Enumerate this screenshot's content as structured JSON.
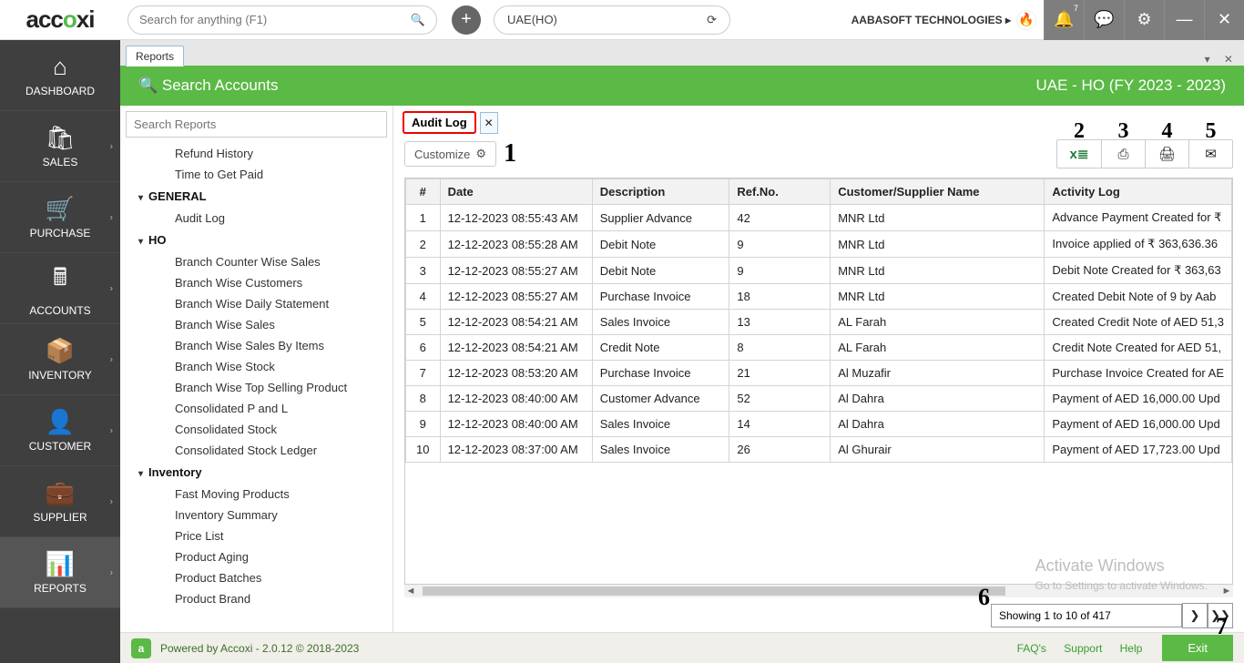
{
  "top": {
    "search_placeholder": "Search for anything (F1)",
    "org": "UAE(HO)",
    "company": "AABASOFT TECHNOLOGIES ▸",
    "notif_count": "7"
  },
  "nav": {
    "dashboard": "DASHBOARD",
    "sales": "SALES",
    "purchase": "PURCHASE",
    "accounts": "ACCOUNTS",
    "inventory": "INVENTORY",
    "customer": "CUSTOMER",
    "supplier": "SUPPLIER",
    "reports": "REPORTS"
  },
  "report_tab": "Reports",
  "green": {
    "search": "Search Accounts",
    "fy": "UAE - HO (FY 2023 - 2023)"
  },
  "tree": {
    "search_placeholder": "Search Reports",
    "items_a": [
      "Refund History",
      "Time to Get Paid"
    ],
    "head1": "GENERAL",
    "items_b": [
      "Audit Log"
    ],
    "head2": "HO",
    "items_c": [
      "Branch Counter Wise Sales",
      "Branch Wise Customers",
      "Branch Wise Daily Statement",
      "Branch Wise Sales",
      "Branch Wise Sales By Items",
      "Branch Wise Stock",
      "Branch Wise Top Selling Product",
      "Consolidated P and L",
      "Consolidated Stock",
      "Consolidated Stock Ledger"
    ],
    "head3": "Inventory",
    "items_d": [
      "Fast Moving Products",
      "Inventory Summary",
      "Price List",
      "Product Aging",
      "Product Batches",
      "Product Brand"
    ]
  },
  "al_tab": "Audit Log",
  "customize": "Customize",
  "cols": [
    "#",
    "Date",
    "Description",
    "Ref.No.",
    "Customer/Supplier Name",
    "Activity Log"
  ],
  "rows": [
    {
      "n": "1",
      "date": "12-12-2023 08:55:43 AM",
      "desc": "Supplier Advance",
      "ref": "42",
      "cust": "MNR Ltd",
      "act": "Advance Payment Created for ₹"
    },
    {
      "n": "2",
      "date": "12-12-2023 08:55:28 AM",
      "desc": "Debit Note",
      "ref": "9",
      "cust": "MNR Ltd",
      "act": "Invoice applied of ₹ 363,636.36"
    },
    {
      "n": "3",
      "date": "12-12-2023 08:55:27 AM",
      "desc": "Debit Note",
      "ref": "9",
      "cust": "MNR Ltd",
      "act": "Debit Note Created for ₹ 363,63"
    },
    {
      "n": "4",
      "date": "12-12-2023 08:55:27 AM",
      "desc": "Purchase Invoice",
      "ref": "18",
      "cust": "MNR Ltd",
      "act": "Created Debit Note of 9 by Aab"
    },
    {
      "n": "5",
      "date": "12-12-2023 08:54:21 AM",
      "desc": "Sales Invoice",
      "ref": "13",
      "cust": "AL Farah",
      "act": "Created Credit Note of AED 51,3"
    },
    {
      "n": "6",
      "date": "12-12-2023 08:54:21 AM",
      "desc": "Credit Note",
      "ref": "8",
      "cust": "AL Farah",
      "act": "Credit Note Created for AED 51,"
    },
    {
      "n": "7",
      "date": "12-12-2023 08:53:20 AM",
      "desc": "Purchase Invoice",
      "ref": "21",
      "cust": "Al Muzafir",
      "act": "Purchase Invoice Created for AE"
    },
    {
      "n": "8",
      "date": "12-12-2023 08:40:00 AM",
      "desc": "Customer Advance",
      "ref": "52",
      "cust": "Al Dahra",
      "act": "Payment of AED 16,000.00 Upd"
    },
    {
      "n": "9",
      "date": "12-12-2023 08:40:00 AM",
      "desc": "Sales Invoice",
      "ref": "14",
      "cust": "Al Dahra",
      "act": "Payment of AED 16,000.00 Upd"
    },
    {
      "n": "10",
      "date": "12-12-2023 08:37:00 AM",
      "desc": "Sales Invoice",
      "ref": "26",
      "cust": "Al Ghurair",
      "act": "Payment of AED 17,723.00 Upd"
    }
  ],
  "pager_text": "Showing 1 to 10 of 417",
  "watermark1": "Activate Windows",
  "watermark2": "Go to Settings to activate Windows.",
  "footer": {
    "powered": "Powered by Accoxi - 2.0.12 © 2018-2023",
    "faq": "FAQ's",
    "support": "Support",
    "help": "Help",
    "exit": "Exit"
  },
  "ann": {
    "1": "1",
    "2": "2",
    "3": "3",
    "4": "4",
    "5": "5",
    "6": "6",
    "7": "7"
  }
}
